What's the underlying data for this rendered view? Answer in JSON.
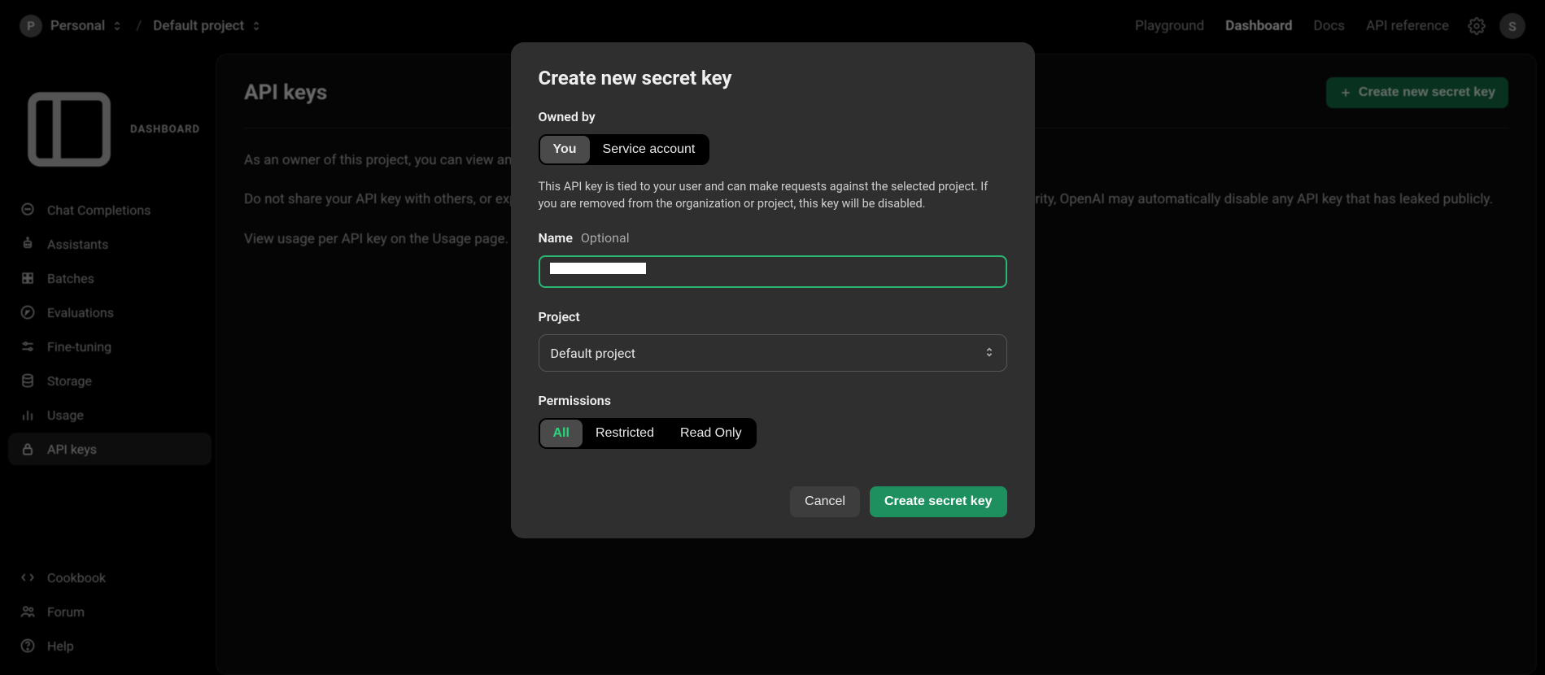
{
  "header": {
    "org_letter": "P",
    "org_name": "Personal",
    "project_name": "Default project",
    "nav": {
      "playground": "Playground",
      "dashboard": "Dashboard",
      "docs": "Docs",
      "api_reference": "API reference"
    },
    "avatar_letter": "S"
  },
  "sidebar": {
    "heading": "DASHBOARD",
    "items": {
      "chat": "Chat Completions",
      "assistants": "Assistants",
      "batches": "Batches",
      "evaluations": "Evaluations",
      "fine_tuning": "Fine-tuning",
      "storage": "Storage",
      "usage": "Usage",
      "api_keys": "API keys"
    },
    "lower": {
      "cookbook": "Cookbook",
      "forum": "Forum",
      "help": "Help"
    }
  },
  "main": {
    "title": "API keys",
    "create_button": "Create new secret key",
    "p1": "As an owner of this project, you can view and manage all API keys in this project.",
    "p2": "Do not share your API key with others, or expose it in the browser or other client-side code. In order to protect your account's security, OpenAI may automatically disable any API key that has leaked publicly.",
    "p3": "View usage per API key on the Usage page."
  },
  "dialog": {
    "title": "Create new secret key",
    "owned_by_label": "Owned by",
    "owner_you": "You",
    "owner_service": "Service account",
    "owner_desc": "This API key is tied to your user and can make requests against the selected project. If you are removed from the organization or project, this key will be disabled.",
    "name_label": "Name",
    "name_optional": "Optional",
    "name_value": "",
    "project_label": "Project",
    "project_selected": "Default project",
    "permissions_label": "Permissions",
    "perm_all": "All",
    "perm_restricted": "Restricted",
    "perm_readonly": "Read Only",
    "cancel": "Cancel",
    "create": "Create secret key"
  }
}
